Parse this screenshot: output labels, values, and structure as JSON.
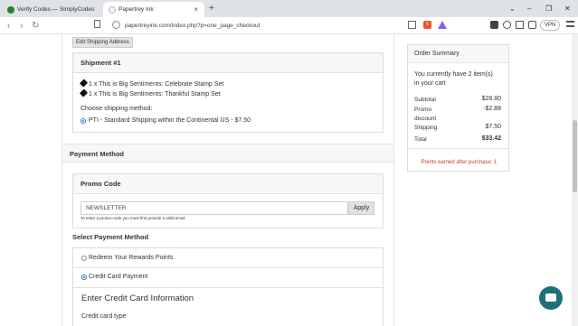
{
  "browser": {
    "tabs": [
      {
        "title": "Verify Codes — SimplyCodes",
        "close": "×"
      },
      {
        "title": "Papertrey Ink",
        "close": "×"
      }
    ],
    "new_tab": "+",
    "window_controls": [
      "⌄",
      "–",
      "❐",
      "✕"
    ],
    "nav": {
      "back": "‹",
      "forward": "›",
      "reload": "↻"
    },
    "url": "papertreyink.com/index.php?p=one_page_checkout",
    "vpn_label": "VPN",
    "shield_badge": "5"
  },
  "page": {
    "edit_shipping_button": "Edit Shipping Address",
    "shipment": {
      "title": "Shipment #1",
      "items": [
        "1 x This is Big Sentiments: Celebrate Stamp Set",
        "1 x This is Big Sentiments: Thankful Stamp Set"
      ],
      "method_label": "Choose shipping method:",
      "method_option": "PTI - Standard Shipping within the Continental US - $7.50"
    },
    "payment": {
      "section_title": "Payment Method",
      "promo_title": "Promo Code",
      "promo_value": "NEWSLETTER",
      "apply_label": "Apply",
      "promo_hint": "To enter a promo-code you must first provide a valid email",
      "select_title": "Select Payment Method",
      "options": [
        "Redeem Your Rewards Points",
        "Credit Card Payment"
      ],
      "cc_title": "Enter Credit Card Information",
      "cc_type_label": "Credit card type"
    },
    "summary": {
      "title": "Order Summary",
      "cart_line1": "You currently have 2 item(s)",
      "cart_line2": "in your cart",
      "subtotal_label": "Subtotal",
      "subtotal_value": "$28.80",
      "promo_label_1": "Promo",
      "promo_label_2": "discount",
      "promo_value": "-$2.88",
      "shipping_label": "Shipping",
      "shipping_value": "$7.50",
      "total_label": "Total",
      "total_value": "$33.42",
      "points_text": "Points earned after purchase: 1"
    }
  },
  "colors": {
    "accent_radio": "#3a6fd8",
    "points_red": "#c0392b",
    "chat_teal": "#1f6f7a"
  }
}
